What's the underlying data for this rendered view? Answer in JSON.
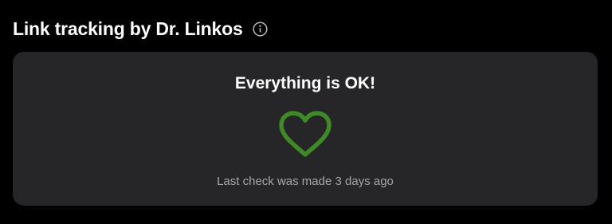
{
  "header": {
    "title": "Link tracking by Dr. Linkos",
    "info_icon": "info-circle-icon"
  },
  "status_card": {
    "title": "Everything is OK!",
    "icon": "heart-icon",
    "icon_color": "#3f8a26",
    "last_check": "Last check was made 3 days ago"
  },
  "colors": {
    "background": "#000000",
    "card_background": "#262628",
    "text_primary": "#ffffff",
    "text_secondary": "#a6a6ab"
  }
}
